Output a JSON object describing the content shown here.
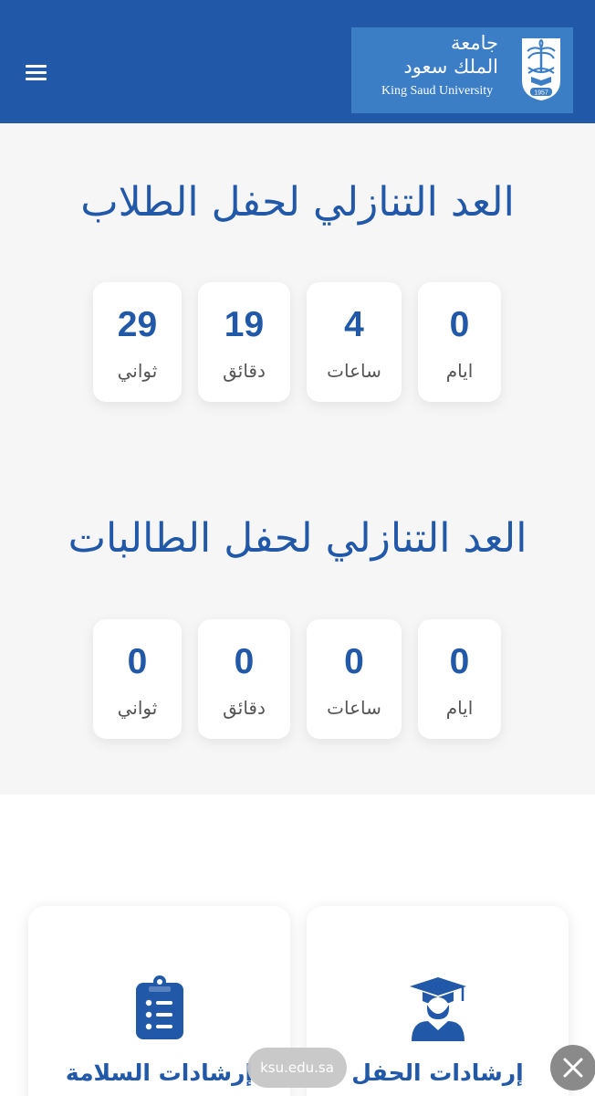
{
  "header": {
    "logo_arabic_line1": "جامعة",
    "logo_arabic_line2": "الملك سعود",
    "logo_english": "King Saud University",
    "logo_emblem_year": "1957",
    "menu_icon": "hamburger-menu-icon",
    "colors": {
      "bar": "#2158a8",
      "logo_bg": "#3b7ec6"
    }
  },
  "students_countdown": {
    "title": "العد التنازلي لحفل الطلاب",
    "units": [
      {
        "value": "29",
        "label": "ثواني"
      },
      {
        "value": "19",
        "label": "دقائق"
      },
      {
        "value": "4",
        "label": "ساعات"
      },
      {
        "value": "0",
        "label": "ايام"
      }
    ]
  },
  "female_students_countdown": {
    "title": "العد التنازلي لحفل الطالبات",
    "units": [
      {
        "value": "0",
        "label": "ثواني"
      },
      {
        "value": "0",
        "label": "دقائق"
      },
      {
        "value": "0",
        "label": "ساعات"
      },
      {
        "value": "0",
        "label": "ايام"
      }
    ]
  },
  "info_cards": [
    {
      "label": "إرشادات السلامة",
      "icon": "clipboard-list-icon"
    },
    {
      "label": "إرشادات الحفل",
      "icon": "graduate-icon"
    }
  ],
  "browser": {
    "url": "ksu.edu.sa",
    "close_icon": "close-icon"
  },
  "colors": {
    "accent": "#2158a8",
    "page_bg": "#f6f6f6",
    "card_bg": "#ffffff"
  }
}
